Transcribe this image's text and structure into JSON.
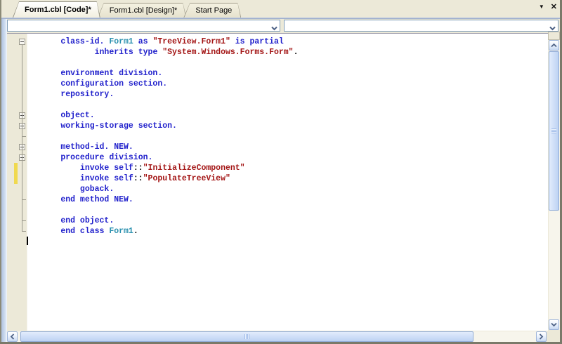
{
  "tabs": [
    {
      "label": "Form1.cbl [Code]*",
      "active": true
    },
    {
      "label": "Form1.cbl [Design]*",
      "active": false
    },
    {
      "label": "Start Page",
      "active": false
    }
  ],
  "window": {
    "menu_glyph": "▼",
    "close_glyph": "✕"
  },
  "navigation_bar": {
    "types_combo_value": "",
    "members_combo_value": ""
  },
  "colors": {
    "keyword": "#2222CC",
    "string": "#A31515",
    "type": "#2B91AF",
    "plain": "#000000",
    "change_bar": "#F0D94F",
    "margin_bg": "#ECE9D8"
  },
  "editor": {
    "language": "COBOL",
    "lines": [
      {
        "indent": 7,
        "fold": "box",
        "segments": [
          {
            "t": "class-id. ",
            "c": "kw"
          },
          {
            "t": "Form1",
            "c": "ty"
          },
          {
            "t": " as ",
            "c": "kw"
          },
          {
            "t": "\"TreeView.Form1\"",
            "c": "st"
          },
          {
            "t": " is partial",
            "c": "kw"
          }
        ]
      },
      {
        "indent": 14,
        "segments": [
          {
            "t": "inherits type ",
            "c": "kw"
          },
          {
            "t": "\"System.Windows.Forms.Form\"",
            "c": "st"
          },
          {
            "t": ".",
            "c": "pl"
          }
        ]
      },
      {
        "indent": 0,
        "segments": []
      },
      {
        "indent": 7,
        "segments": [
          {
            "t": "environment division.",
            "c": "kw"
          }
        ]
      },
      {
        "indent": 7,
        "segments": [
          {
            "t": "configuration section.",
            "c": "kw"
          }
        ]
      },
      {
        "indent": 7,
        "segments": [
          {
            "t": "repository.",
            "c": "kw"
          }
        ]
      },
      {
        "indent": 0,
        "segments": []
      },
      {
        "indent": 7,
        "fold": "box",
        "segments": [
          {
            "t": "object.",
            "c": "kw"
          }
        ]
      },
      {
        "indent": 7,
        "fold": "box",
        "segments": [
          {
            "t": "working-storage section.",
            "c": "kw"
          }
        ]
      },
      {
        "indent": 0,
        "fold": "tick",
        "segments": []
      },
      {
        "indent": 7,
        "fold": "box",
        "segments": [
          {
            "t": "method-id. NEW.",
            "c": "kw"
          }
        ]
      },
      {
        "indent": 7,
        "fold": "box",
        "segments": [
          {
            "t": "procedure division.",
            "c": "kw"
          }
        ]
      },
      {
        "indent": 11,
        "changed": true,
        "segments": [
          {
            "t": "invoke self",
            "c": "kw"
          },
          {
            "t": "::",
            "c": "pl"
          },
          {
            "t": "\"InitializeComponent\"",
            "c": "st"
          }
        ]
      },
      {
        "indent": 11,
        "changed": true,
        "segments": [
          {
            "t": "invoke self",
            "c": "kw"
          },
          {
            "t": "::",
            "c": "pl"
          },
          {
            "t": "\"PopulateTreeView\"",
            "c": "st"
          }
        ]
      },
      {
        "indent": 11,
        "segments": [
          {
            "t": "goback.",
            "c": "kw"
          }
        ]
      },
      {
        "indent": 7,
        "fold": "tick",
        "segments": [
          {
            "t": "end method NEW.",
            "c": "kw"
          }
        ]
      },
      {
        "indent": 0,
        "segments": []
      },
      {
        "indent": 7,
        "fold": "tick",
        "segments": [
          {
            "t": "end object.",
            "c": "kw"
          }
        ]
      },
      {
        "indent": 7,
        "fold": "corner",
        "segments": [
          {
            "t": "end class ",
            "c": "kw"
          },
          {
            "t": "Form1",
            "c": "ty"
          },
          {
            "t": ".",
            "c": "pl"
          }
        ]
      },
      {
        "indent": 0,
        "cursor": true,
        "segments": []
      }
    ]
  }
}
